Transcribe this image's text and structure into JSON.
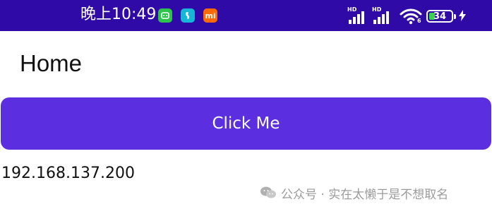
{
  "status_bar": {
    "time": "晚上10:49",
    "battery_level": "34",
    "battery_fraction": 0.34,
    "signal_badge_1": "HD",
    "signal_badge_2": "HD",
    "wifi_badge": "6",
    "app_icons": [
      "notification-app-icon",
      "notification-app-icon",
      "mi-icon"
    ],
    "mi_label": "mi"
  },
  "page": {
    "title": "Home"
  },
  "button": {
    "label": "Click Me"
  },
  "info": {
    "ip_address": "192.168.137.200"
  },
  "watermark": {
    "text": "公众号 · 实在太懒于是不想取名"
  },
  "colors": {
    "status_bar_bg": "#2f0aa6",
    "button_bg": "#5b2fe0",
    "button_text": "#ffffff",
    "battery_fill": "#37d24a",
    "watermark": "#9b9b9b"
  }
}
